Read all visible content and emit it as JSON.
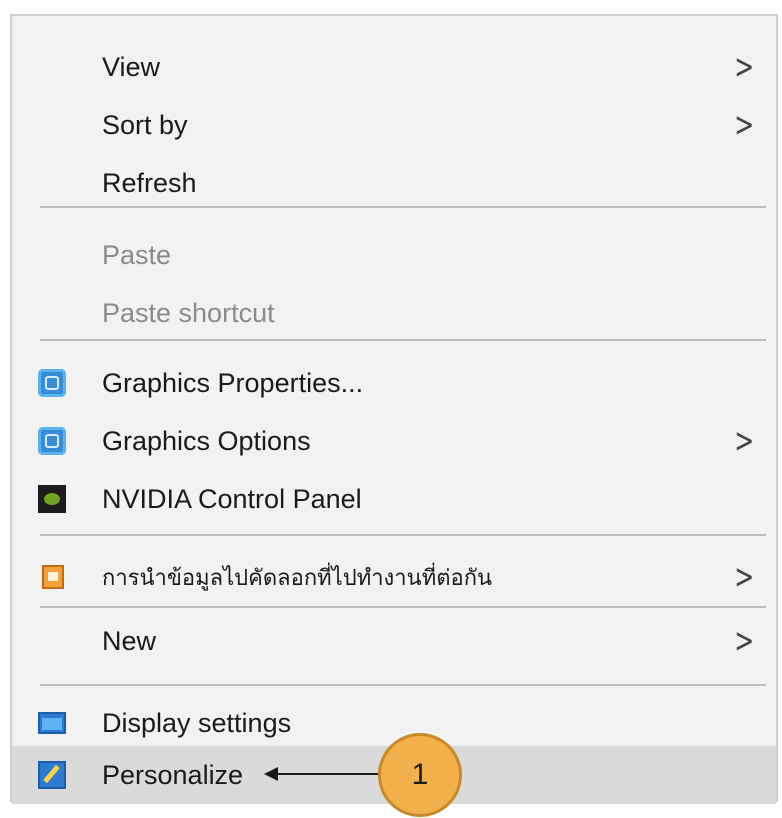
{
  "menu": {
    "items": [
      {
        "label": "View",
        "submenu": true,
        "enabled": true
      },
      {
        "label": "Sort by",
        "submenu": true,
        "enabled": true
      },
      {
        "label": "Refresh",
        "submenu": false,
        "enabled": true
      },
      {
        "label": "Paste",
        "submenu": false,
        "enabled": false
      },
      {
        "label": "Paste shortcut",
        "submenu": false,
        "enabled": false
      },
      {
        "label": "Graphics Properties...",
        "icon": "intel-graphics-icon",
        "submenu": false,
        "enabled": true
      },
      {
        "label": "Graphics Options",
        "icon": "intel-graphics-icon",
        "submenu": true,
        "enabled": true
      },
      {
        "label": "NVIDIA Control Panel",
        "icon": "nvidia-icon",
        "submenu": false,
        "enabled": true
      },
      {
        "label": "การนำข้อมูลไปคัดลอกที่ไปทำงานที่ต่อกัน",
        "icon": "thai-app-icon",
        "submenu": true,
        "enabled": true
      },
      {
        "label": "New",
        "submenu": true,
        "enabled": true
      },
      {
        "label": "Display settings",
        "icon": "display-icon",
        "submenu": false,
        "enabled": true
      },
      {
        "label": "Personalize",
        "icon": "personalize-icon",
        "submenu": false,
        "enabled": true,
        "highlighted": true
      }
    ],
    "submenu_glyph": ">"
  },
  "callout": {
    "number": "1"
  },
  "colors": {
    "menu_bg": "#f2f2f2",
    "hover_bg": "#dadada",
    "disabled_text": "#8a8a8a",
    "badge": "#f2b04a"
  }
}
